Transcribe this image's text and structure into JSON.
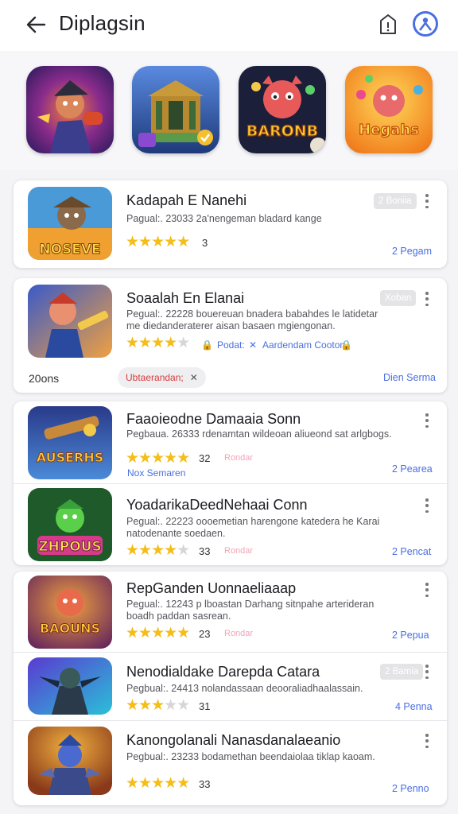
{
  "header": {
    "title": "Diplagsin"
  },
  "featured": [
    {
      "name": "featured-hero-game",
      "label": ""
    },
    {
      "name": "featured-temple-game",
      "label": ""
    },
    {
      "name": "featured-baronb-game",
      "label": "BARONB"
    },
    {
      "name": "featured-hegahs-game",
      "label": "Hegahs"
    }
  ],
  "apps": [
    {
      "name": "Kadapah E Nanehi",
      "desc1": "Pagual:. 23033 2a'nengeman bladard kange",
      "rating": "3",
      "badge": "2 Boniia",
      "action": "2 Pegam",
      "icon_text": "NOSEVE"
    },
    {
      "name": "Soaalah En Elanai",
      "desc1": "Pegual:. 22228 bouereuan bnadera babahdes le latidetar",
      "desc2": "me diedanderaterer aisan basaen mgiengonan.",
      "badge": "Xoban",
      "meta1": "Podat:",
      "meta2": "Aardendam Cooton",
      "count": "20ons",
      "chip": "Ubtaerandan;",
      "action": "Dien Serma",
      "icon_text": ""
    },
    {
      "name": "Faaoieodne Damaaia Sonn",
      "desc1": "Pegbaua. 26333 rdenamtan wildeoan aliueond sat arlgbogs.",
      "rating": "32",
      "faint": "Rondar",
      "sub": "Nox Semaren",
      "action": "2 Pearea",
      "icon_text": "AUSERHS"
    },
    {
      "name": "YoadarikaDeedNehaai Conn",
      "desc1": "Pegual:. 22223 oooemetian harengone katedera he Karai",
      "desc2": "natodenante soedaen.",
      "rating": "33",
      "faint": "Rondar",
      "action": "2 Pencat",
      "icon_text": "ZHPOUS"
    },
    {
      "name": "RepGanden Uonnaeliaaap",
      "desc1": "Pegual:. 12243 p lboastan Darhang sitnpahe arterideran",
      "desc2": "boadh paddan sasrean.",
      "rating": "23",
      "faint": "Rondar",
      "action": "2 Pepua",
      "icon_text": "BAOUNS"
    },
    {
      "name": "Nenodialdake Darepda Catara",
      "desc1": "Pegbual:. 24413 nolandassaan deooraliadhaalassain.",
      "rating": "31",
      "badge": "2 Bamia",
      "action": "4 Penna",
      "icon_text": ""
    },
    {
      "name": "Kanongolanali Nanasdanalaeanio",
      "desc1": "Pegbual:. 23233 bodamethan beendaiolaa tiklap kaoam.",
      "rating": "33",
      "action": "2 Penno",
      "icon_text": ""
    }
  ],
  "colors": {
    "accent": "#4a6fe0",
    "star": "#f4bd17"
  }
}
